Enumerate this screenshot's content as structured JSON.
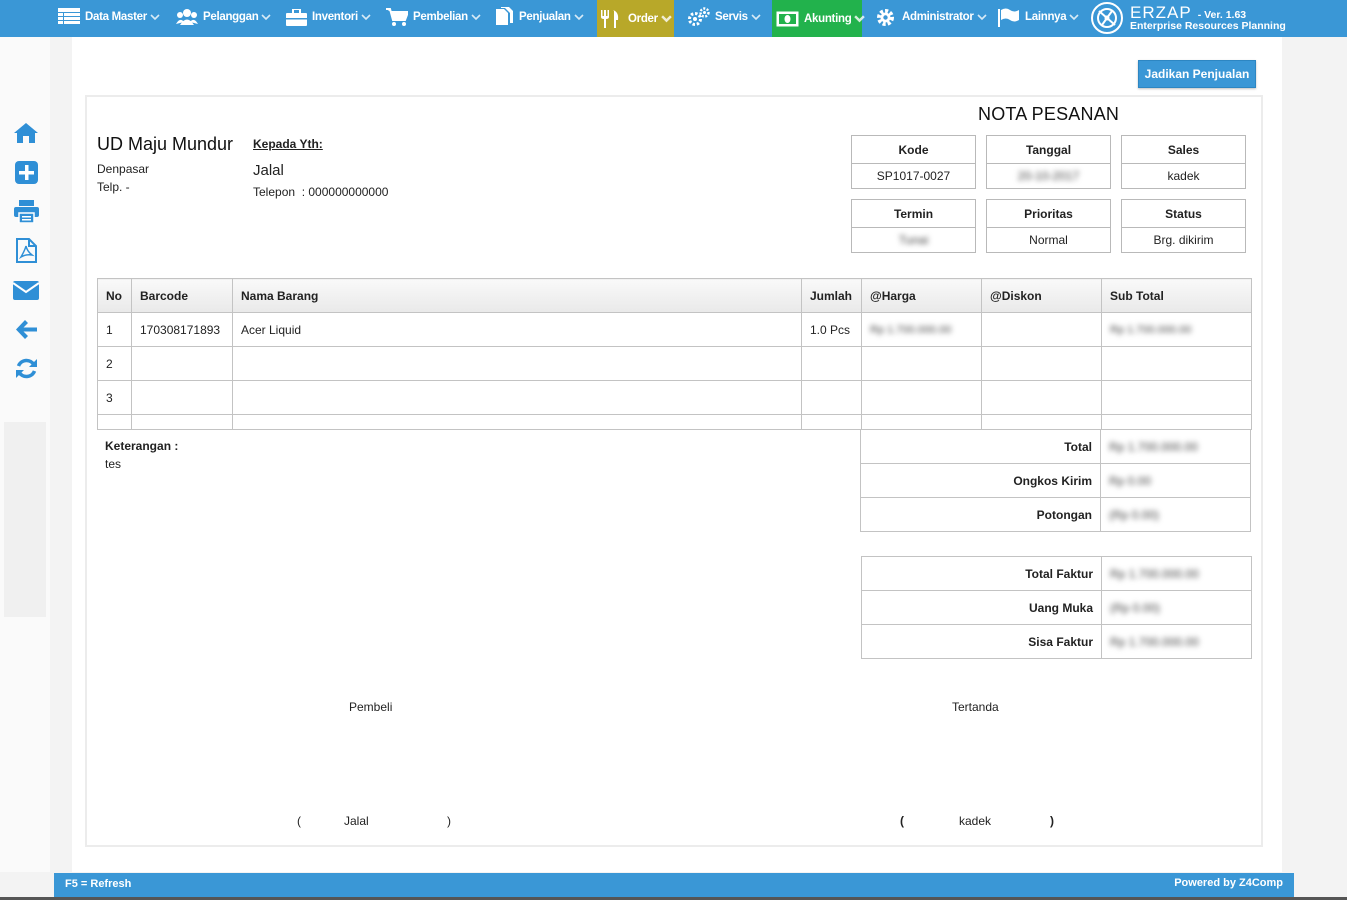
{
  "nav": {
    "items": [
      {
        "label": "Data Master",
        "icon": "table-icon"
      },
      {
        "label": "Pelanggan",
        "icon": "users-icon"
      },
      {
        "label": "Inventori",
        "icon": "briefcase-icon"
      },
      {
        "label": "Pembelian",
        "icon": "cart-icon"
      },
      {
        "label": "Penjualan",
        "icon": "document-icon"
      },
      {
        "label": "Order",
        "icon": "cutlery-icon"
      },
      {
        "label": "Servis",
        "icon": "cogs-icon"
      },
      {
        "label": "Akunting",
        "icon": "money-icon"
      },
      {
        "label": "Administrator",
        "icon": "gear-icon"
      },
      {
        "label": "Lainnya",
        "icon": "flag-icon"
      }
    ],
    "active_colors": {
      "order": "#b8a829",
      "akunting": "#22b24c"
    },
    "brand": {
      "name": "ERZAP",
      "version": "- Ver. 1.63",
      "tagline": "Enterprise Resources Planning"
    }
  },
  "sidebar": {
    "icons": [
      "home-icon",
      "plus-square-icon",
      "print-icon",
      "pdf-icon",
      "envelope-icon",
      "arrow-left-icon",
      "refresh-icon"
    ]
  },
  "actions": {
    "convert_label": "Jadikan Penjualan"
  },
  "document": {
    "title": "NOTA PESANAN",
    "company": {
      "name": "UD Maju Mundur",
      "city": "Denpasar",
      "telp": "Telp. -"
    },
    "customer": {
      "kepada_label": "Kepada Yth:",
      "name": "Jalal",
      "phone": "Telepon  : 000000000000"
    },
    "info": {
      "kode": {
        "label": "Kode",
        "value": "SP1017-0027"
      },
      "tanggal": {
        "label": "Tanggal",
        "value": "20-10-2017"
      },
      "sales": {
        "label": "Sales",
        "value": "kadek"
      },
      "termin": {
        "label": "Termin",
        "value": "Tunai"
      },
      "prioritas": {
        "label": "Prioritas",
        "value": "Normal"
      },
      "status": {
        "label": "Status",
        "value": "Brg. dikirim"
      }
    },
    "table": {
      "headers": [
        "No",
        "Barcode",
        "Nama Barang",
        "Jumlah",
        "@Harga",
        "@Diskon",
        "Sub Total"
      ],
      "rows": [
        {
          "no": "1",
          "barcode": "170308171893",
          "nama": "Acer Liquid",
          "jumlah": "1.0 Pcs",
          "harga": "Rp 1.700.000.00",
          "diskon": "",
          "subtotal": "Rp 1.700.000.00"
        },
        {
          "no": "2",
          "barcode": "",
          "nama": "",
          "jumlah": "",
          "harga": "",
          "diskon": "",
          "subtotal": ""
        },
        {
          "no": "3",
          "barcode": "",
          "nama": "",
          "jumlah": "",
          "harga": "",
          "diskon": "",
          "subtotal": ""
        }
      ]
    },
    "keterangan": {
      "label": "Keterangan :",
      "value": "tes"
    },
    "summary": {
      "total": {
        "label": "Total",
        "value": "Rp 1.700.000.00"
      },
      "ongkos_kirim": {
        "label": "Ongkos Kirim",
        "value": "Rp 0.00"
      },
      "potongan": {
        "label": "Potongan",
        "value": "(Rp 0.00)"
      },
      "total_faktur": {
        "label": "Total Faktur",
        "value": "Rp 1.700.000.00"
      },
      "uang_muka": {
        "label": "Uang Muka",
        "value": "(Rp 0.00)"
      },
      "sisa_faktur": {
        "label": "Sisa Faktur",
        "value": "Rp 1.700.000.00"
      }
    },
    "signatures": {
      "pembeli_label": "Pembeli",
      "pembeli_name": "Jalal",
      "tertanda_label": "Tertanda",
      "tertanda_name": "kadek"
    }
  },
  "footer": {
    "left": "F5 = Refresh",
    "right": "Powered by Z4Comp"
  }
}
